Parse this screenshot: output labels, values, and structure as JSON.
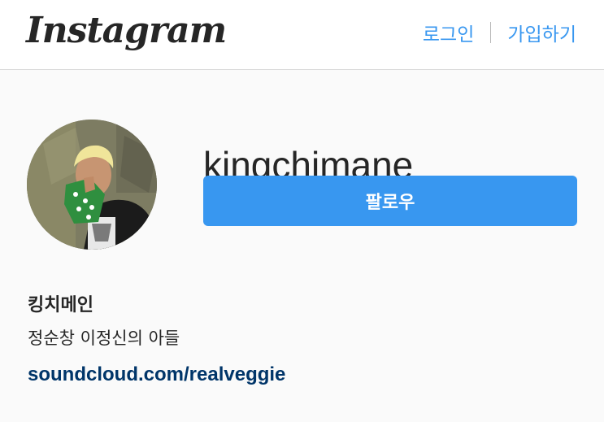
{
  "header": {
    "logo_text": "Instagram",
    "login_label": "로그인",
    "signup_label": "가입하기"
  },
  "profile": {
    "username": "kingchimane",
    "follow_label": "팔로우",
    "full_name": "킹치메인",
    "bio": "정순창 이정신의 아들",
    "link": "soundcloud.com/realveggie"
  },
  "colors": {
    "accent": "#3897f0",
    "link": "#003569",
    "text": "#262626",
    "background": "#fafafa"
  }
}
